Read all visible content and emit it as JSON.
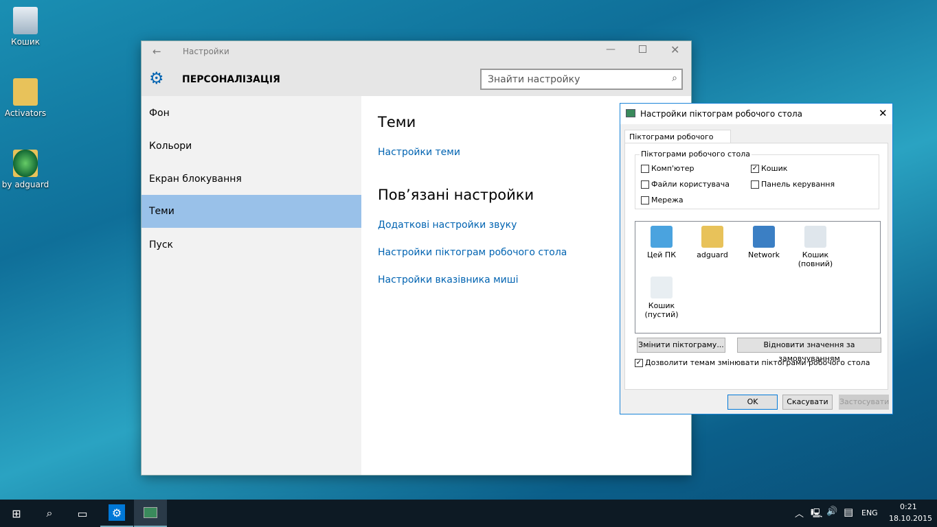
{
  "desktop": {
    "icons": [
      {
        "label": "Кошик",
        "icon": "recycle-bin-icon"
      },
      {
        "label": "Activators",
        "icon": "folder-shortcut-icon"
      },
      {
        "label": "by adguard",
        "icon": "globe-shortcut-icon"
      }
    ]
  },
  "settings": {
    "title": "Настройки",
    "header": "ПЕРСОНАЛІЗАЦІЯ",
    "search_placeholder": "Знайти настройку",
    "sidebar": [
      {
        "label": "Фон"
      },
      {
        "label": "Кольори"
      },
      {
        "label": "Екран блокування"
      },
      {
        "label": "Теми",
        "selected": true
      },
      {
        "label": "Пуск"
      }
    ],
    "main": {
      "section1": "Теми",
      "theme_link": "Настройки теми",
      "section2": "Пов’язані настройки",
      "links": [
        "Додаткові настройки звуку",
        "Настройки піктограм робочого стола",
        "Настройки вказівника миші"
      ]
    }
  },
  "dialog": {
    "title": "Настройки піктограм робочого стола",
    "tab": "Піктограми робочого стола",
    "group": "Піктограми робочого стола",
    "checkboxes": [
      {
        "label": "Комп'ютер",
        "checked": false
      },
      {
        "label": "Кошик",
        "checked": true
      },
      {
        "label": "Файли користувача",
        "checked": false
      },
      {
        "label": "Панель керування",
        "checked": false
      },
      {
        "label": "Мережа",
        "checked": false
      }
    ],
    "icons": [
      {
        "label": "Цей ПК"
      },
      {
        "label": "adguard"
      },
      {
        "label": "Network"
      },
      {
        "label": "Кошик\n(повний)"
      },
      {
        "label": "Кошик\n(пустий)"
      }
    ],
    "change_icon": "Змінити піктограму...",
    "restore_default": "Відновити значення за замовчуванням",
    "allow_themes": "Дозволити темам змінювати піктограми робочого стола",
    "allow_themes_checked": true,
    "ok": "OK",
    "cancel": "Скасувати",
    "apply": "Застосувати"
  },
  "taskbar": {
    "lang": "ENG",
    "time": "0:21",
    "date": "18.10.2015"
  },
  "colors": {
    "accent": "#0063b1",
    "selected": "#99c1e9",
    "taskbar": "#0d1a24"
  }
}
